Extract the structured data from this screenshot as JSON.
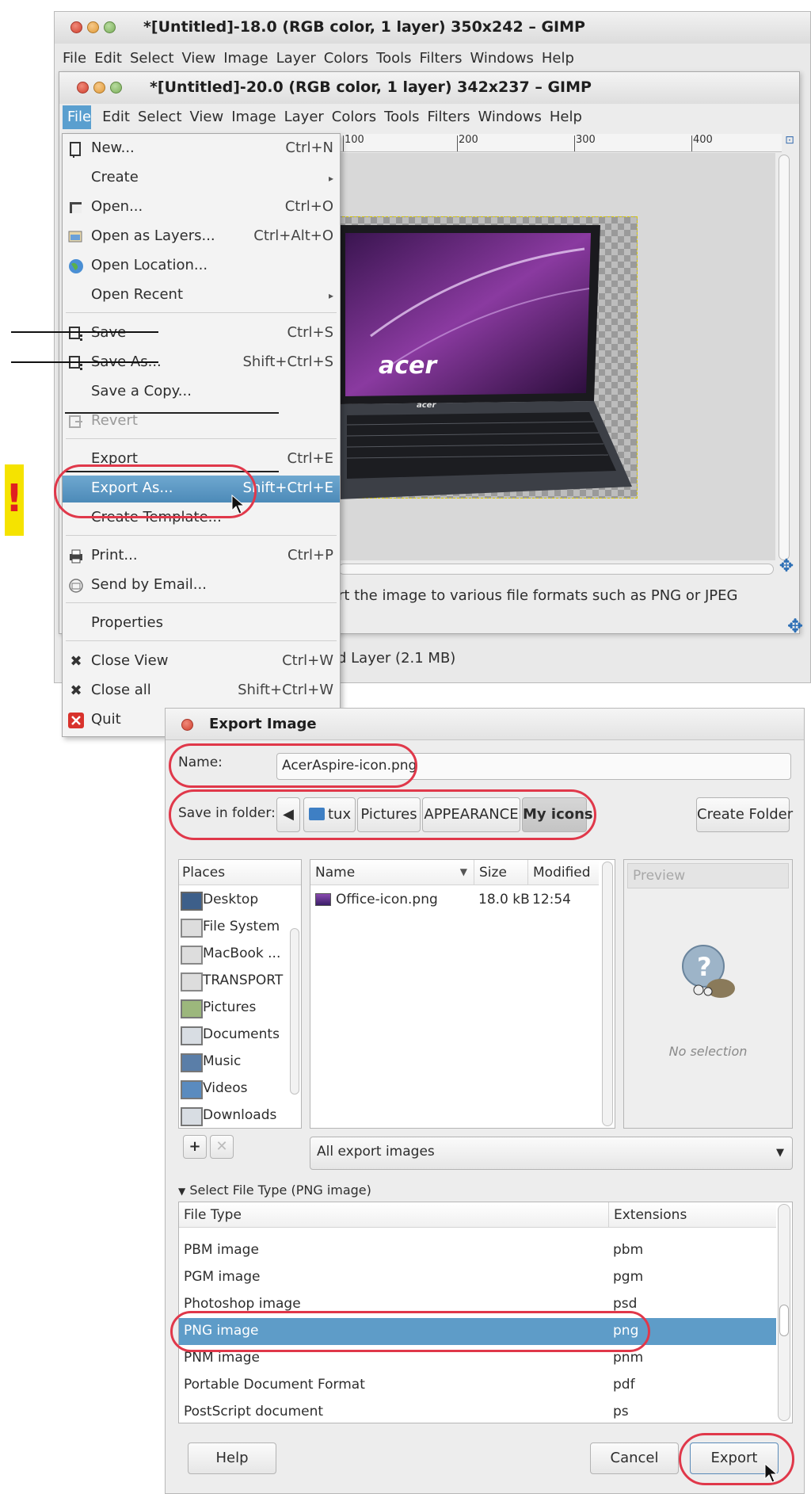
{
  "back_window": {
    "title": "*[Untitled]-18.0 (RGB color, 1 layer) 350x242 – GIMP",
    "menu": [
      "File",
      "Edit",
      "Select",
      "View",
      "Image",
      "Layer",
      "Colors",
      "Tools",
      "Filters",
      "Windows",
      "Help"
    ]
  },
  "front_window": {
    "title": "*[Untitled]-20.0 (RGB color, 1 layer) 342x237 – GIMP",
    "menu": [
      "File",
      "Edit",
      "Select",
      "View",
      "Image",
      "Layer",
      "Colors",
      "Tools",
      "Filters",
      "Windows",
      "Help"
    ],
    "ruler_labels": [
      "100",
      "200",
      "300",
      "400"
    ],
    "status_hint": "rt the image to various file formats such as PNG or JPEG",
    "status_layer": "d Layer (2.1 MB)",
    "image_text": [
      "acer",
      "acer"
    ]
  },
  "file_menu": {
    "items": [
      {
        "label": "New...",
        "accel": "Ctrl+N",
        "icon": "new-icon"
      },
      {
        "label": "Create",
        "accel": "",
        "submenu": true
      },
      {
        "label": "Open...",
        "accel": "Ctrl+O",
        "icon": "open-icon"
      },
      {
        "label": "Open as Layers...",
        "accel": "Ctrl+Alt+O",
        "icon": "open-layers-icon"
      },
      {
        "label": "Open Location...",
        "accel": "",
        "icon": "globe-icon"
      },
      {
        "label": "Open Recent",
        "accel": "",
        "submenu": true
      },
      {
        "label": "Save",
        "accel": "Ctrl+S",
        "icon": "save-icon"
      },
      {
        "label": "Save As...",
        "accel": "Shift+Ctrl+S",
        "icon": "save-as-icon"
      },
      {
        "label": "Save a Copy...",
        "accel": ""
      },
      {
        "label": "Revert",
        "accel": "",
        "icon": "revert-icon",
        "disabled": true
      },
      {
        "label": "Export",
        "accel": "Ctrl+E"
      },
      {
        "label": "Export As...",
        "accel": "Shift+Ctrl+E",
        "selected": true
      },
      {
        "label": "Create Template...",
        "accel": ""
      },
      {
        "label": "Print...",
        "accel": "Ctrl+P",
        "icon": "print-icon"
      },
      {
        "label": "Send by Email...",
        "accel": "",
        "icon": "email-icon"
      },
      {
        "label": "Properties",
        "accel": ""
      },
      {
        "label": "Close View",
        "accel": "Ctrl+W",
        "icon": "close-x-icon"
      },
      {
        "label": "Close all",
        "accel": "Shift+Ctrl+W",
        "icon": "close-x-icon"
      },
      {
        "label": "Quit",
        "accel": "",
        "icon": "quit-icon"
      }
    ]
  },
  "annotation": {
    "exclamation": "!"
  },
  "dialog": {
    "title": "Export Image",
    "name_label": "Name:",
    "name_value": "AcerAspire-icon.png",
    "folder_label": "Save in folder:",
    "breadcrumbs": [
      "tux",
      "Pictures",
      "APPEARANCE",
      "My icons"
    ],
    "create_folder": "Create Folder",
    "places_header": "Places",
    "places": [
      {
        "label": "Desktop",
        "icon": "desktop-icon"
      },
      {
        "label": "File System",
        "icon": "drive-icon"
      },
      {
        "label": "MacBook ...",
        "icon": "drive-icon"
      },
      {
        "label": "TRANSPORT",
        "icon": "drive-icon"
      },
      {
        "label": "Pictures",
        "icon": "pictures-folder-icon"
      },
      {
        "label": "Documents",
        "icon": "documents-folder-icon"
      },
      {
        "label": "Music",
        "icon": "music-folder-icon"
      },
      {
        "label": "Videos",
        "icon": "videos-folder-icon"
      },
      {
        "label": "Downloads",
        "icon": "downloads-folder-icon"
      }
    ],
    "files_headers": {
      "name": "Name",
      "size": "Size",
      "modified": "Modified"
    },
    "files": [
      {
        "name": "Office-icon.png",
        "size": "18.0 kB",
        "modified": "12:54"
      }
    ],
    "preview_header": "Preview",
    "no_selection": "No selection",
    "filter": "All export images",
    "select_type": "Select File Type (PNG image)",
    "type_headers": {
      "type": "File Type",
      "ext": "Extensions"
    },
    "file_types": [
      {
        "type": "PBM image",
        "ext": "pbm"
      },
      {
        "type": "PGM image",
        "ext": "pgm"
      },
      {
        "type": "Photoshop image",
        "ext": "psd"
      },
      {
        "type": "PNG image",
        "ext": "png",
        "selected": true
      },
      {
        "type": "PNM image",
        "ext": "pnm"
      },
      {
        "type": "Portable Document Format",
        "ext": "pdf"
      },
      {
        "type": "PostScript document",
        "ext": "ps"
      }
    ],
    "help": "Help",
    "cancel": "Cancel",
    "export": "Export"
  },
  "colors": {
    "highlight_oval": "#e0384a",
    "menu_selected": "#5e9cc8",
    "warning_bg": "#f5e300",
    "warning_fg": "#e02020"
  }
}
